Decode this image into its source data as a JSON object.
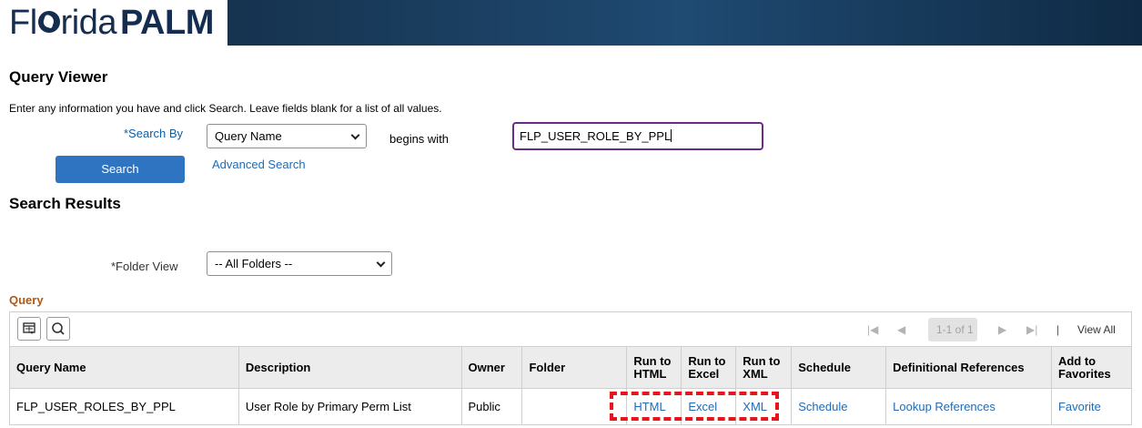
{
  "header": {
    "logo_part1": "Fl",
    "logo_part2": "rida",
    "logo_part3": "PALM"
  },
  "page": {
    "title": "Query Viewer",
    "instructions": "Enter any information you have and click Search. Leave fields blank for a list of all values."
  },
  "search": {
    "search_by_label": "*Search By",
    "search_by_value": "Query Name",
    "operator_label": "begins with",
    "input_value": "FLP_USER_ROLE_BY_PPL",
    "search_button": "Search",
    "advanced_link": "Advanced Search"
  },
  "results": {
    "title": "Search Results",
    "folder_view_label": "*Folder View",
    "folder_view_value": "-- All Folders --"
  },
  "grid": {
    "title": "Query",
    "pager_first": "|◀",
    "pager_prev": "◀",
    "pager_range": "1-1 of 1",
    "pager_next": "▶",
    "pager_last": "▶|",
    "pager_sep": "|",
    "view_all": "View All",
    "columns": [
      {
        "line1": "Query Name",
        "line2": ""
      },
      {
        "line1": "Description",
        "line2": ""
      },
      {
        "line1": "Owner",
        "line2": ""
      },
      {
        "line1": "Folder",
        "line2": ""
      },
      {
        "line1": "Run to",
        "line2": "HTML"
      },
      {
        "line1": "Run to",
        "line2": "Excel"
      },
      {
        "line1": "Run to",
        "line2": "XML"
      },
      {
        "line1": "Schedule",
        "line2": ""
      },
      {
        "line1": "Definitional References",
        "line2": ""
      },
      {
        "line1": "Add to",
        "line2": "Favorites"
      }
    ],
    "rows": [
      {
        "query_name": "FLP_USER_ROLES_BY_PPL",
        "description": "User Role by Primary Perm List",
        "owner": "Public",
        "folder": "",
        "run_html": "HTML",
        "run_excel": "Excel",
        "run_xml": "XML",
        "schedule": "Schedule",
        "definitional_references": "Lookup References",
        "favorites": "Favorite"
      }
    ]
  },
  "colors": {
    "banner": "#1f4a72",
    "link": "#1f6bb5",
    "button": "#2f74c0",
    "highlight": "#e8141b",
    "query_title": "#b4560f"
  },
  "icons": [
    "personalize-grid-icon",
    "search-icon",
    "chevron-down-icon"
  ]
}
